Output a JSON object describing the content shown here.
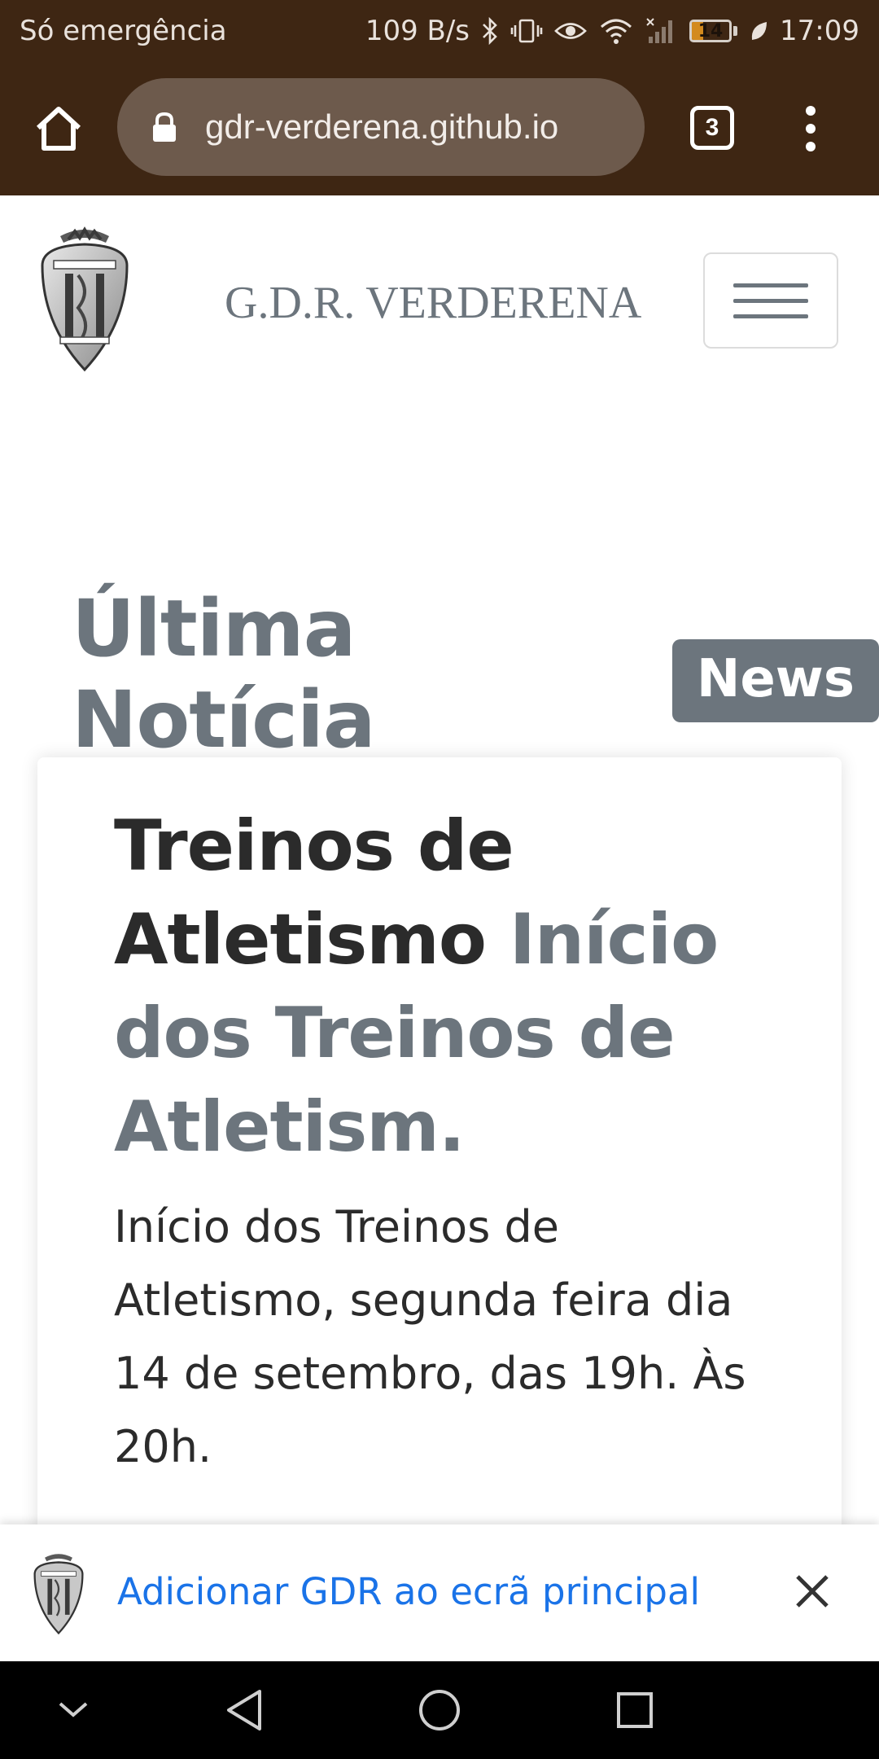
{
  "status_bar": {
    "carrier": "Só emergência",
    "net_speed": "109 B/s",
    "battery_level": "14",
    "time": "17:09",
    "icons": [
      "bluetooth-icon",
      "vibrate-icon",
      "eye-icon",
      "wifi-icon",
      "signal-icon",
      "battery-icon",
      "leaf-icon"
    ]
  },
  "browser": {
    "url": "gdr-verderena.github.io",
    "tab_count": "3",
    "icons": [
      "home-icon",
      "lock-icon",
      "tabs-icon",
      "more-vert-icon"
    ]
  },
  "header": {
    "brand": "G.D.R. VERDERENA",
    "logo_icon": "club-crest-icon",
    "menu_icon": "hamburger-menu-icon"
  },
  "section": {
    "title": "Última Notícia",
    "badge": "News"
  },
  "news": {
    "title": "Treinos de Atletismo",
    "subtitle": "Início dos Treinos de Atletism.",
    "body": "Início dos Treinos de Atletismo, segunda feira dia 14 de setembro, das 19h. Às 20h."
  },
  "install_banner": {
    "text": "Adicionar GDR ao ecrã principal",
    "close_icon": "close-icon"
  },
  "nav_bar": {
    "icons": [
      "collapse-icon",
      "back-icon",
      "home-circle-icon",
      "recents-icon"
    ]
  },
  "colors": {
    "browser_bg": "#3e2613",
    "url_pill": "#6d5a4c",
    "muted_text": "#6c757d",
    "link_blue": "#1a73e8",
    "battery_fill": "#d38a1e"
  }
}
